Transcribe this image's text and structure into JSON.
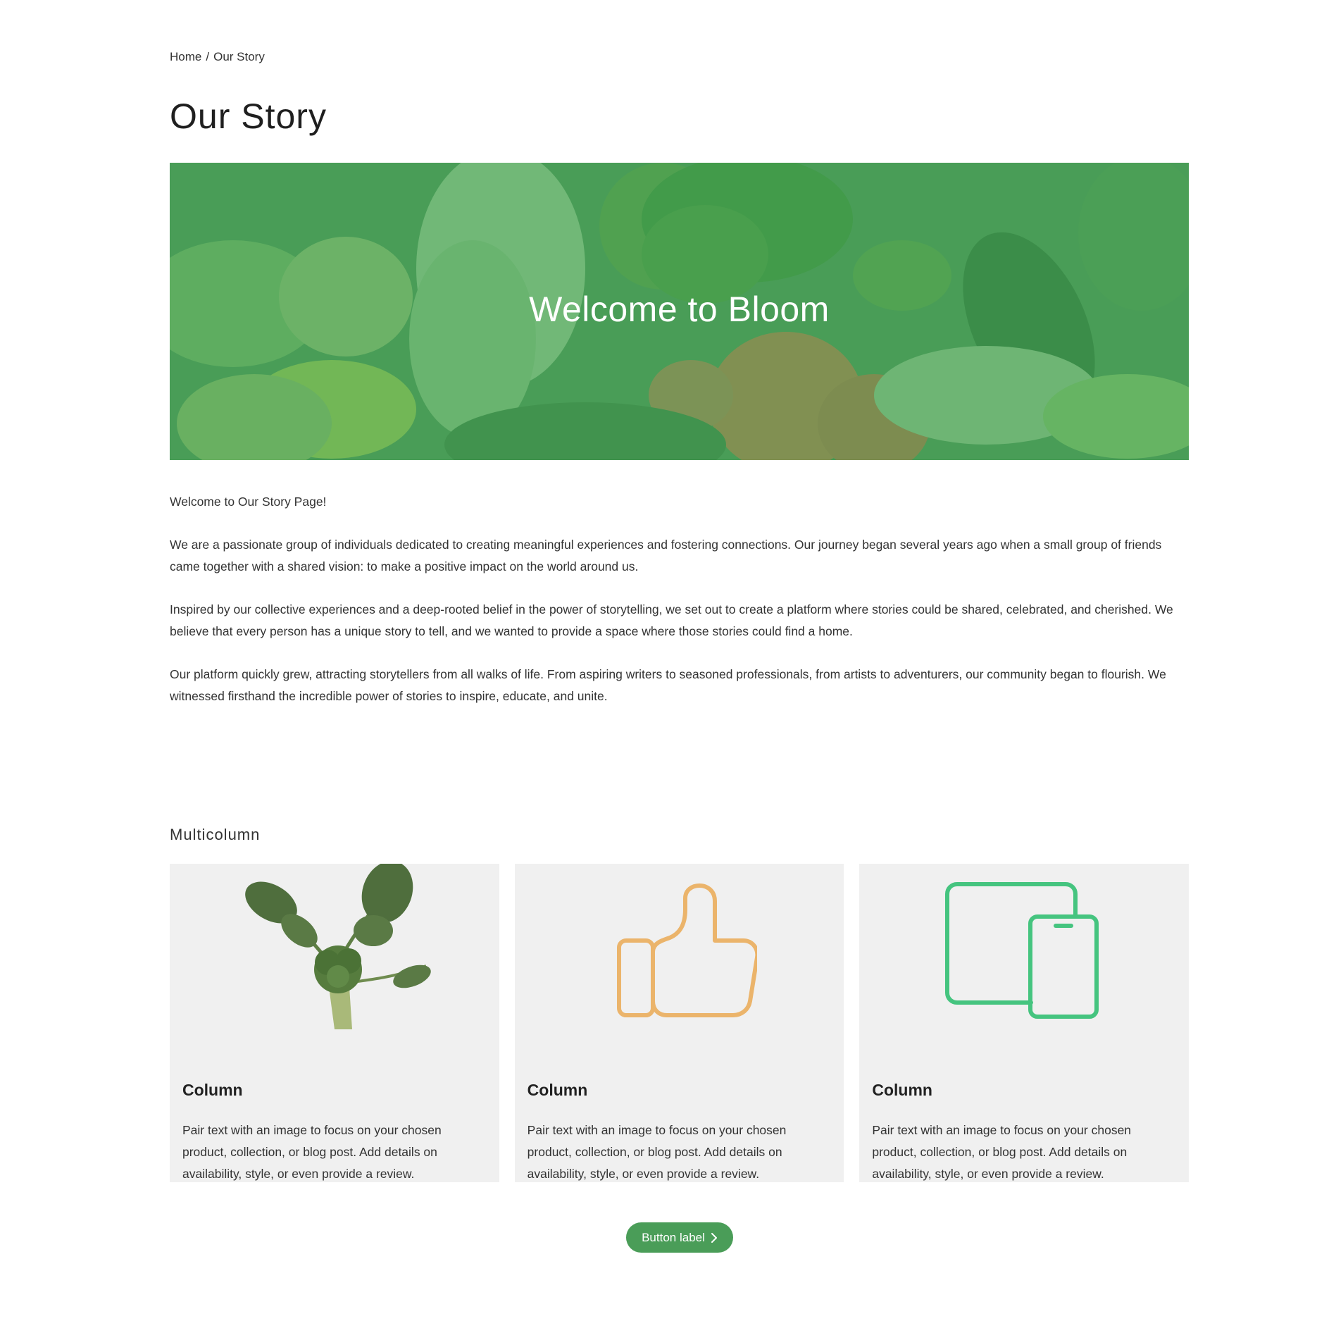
{
  "breadcrumb": {
    "home": "Home",
    "separator": "/",
    "current": "Our Story"
  },
  "page_title": "Our Story",
  "hero": {
    "heading": "Welcome to Bloom",
    "overlay_color": "#4a9d58"
  },
  "story": {
    "intro": "Welcome to Our Story Page!",
    "paragraphs": [
      "We are a passionate group of individuals dedicated to creating meaningful experiences and fostering connections. Our journey began several years ago when a small group of friends came together with a shared vision: to make a positive impact on the world around us.",
      "Inspired by our collective experiences and a deep-rooted belief in the power of storytelling, we set out to create a platform where stories could be shared, celebrated, and cherished. We believe that every person has a unique story to tell, and we wanted to provide a space where those stories could find a home.",
      "Our platform quickly grew, attracting storytellers from all walks of life. From aspiring writers to seasoned professionals, from artists to adventurers, our community began to flourish. We witnessed firsthand the incredible power of stories to inspire, educate, and unite."
    ]
  },
  "multicolumn": {
    "title": "Multicolumn",
    "columns": [
      {
        "icon": "broccoli-image",
        "title": "Column",
        "text": "Pair text with an image to focus on your chosen product, collection, or blog post. Add details on availability, style, or even provide a review."
      },
      {
        "icon": "thumbs-up-icon",
        "icon_color": "#ebb46b",
        "title": "Column",
        "text": "Pair text with an image to focus on your chosen product, collection, or blog post. Add details on availability, style, or even provide a review."
      },
      {
        "icon": "devices-icon",
        "icon_color": "#45c47f",
        "title": "Column",
        "text": "Pair text with an image to focus on your chosen product, collection, or blog post. Add details on availability, style, or even provide a review."
      }
    ],
    "button_label": "Button label",
    "button_color": "#4a9d58"
  }
}
